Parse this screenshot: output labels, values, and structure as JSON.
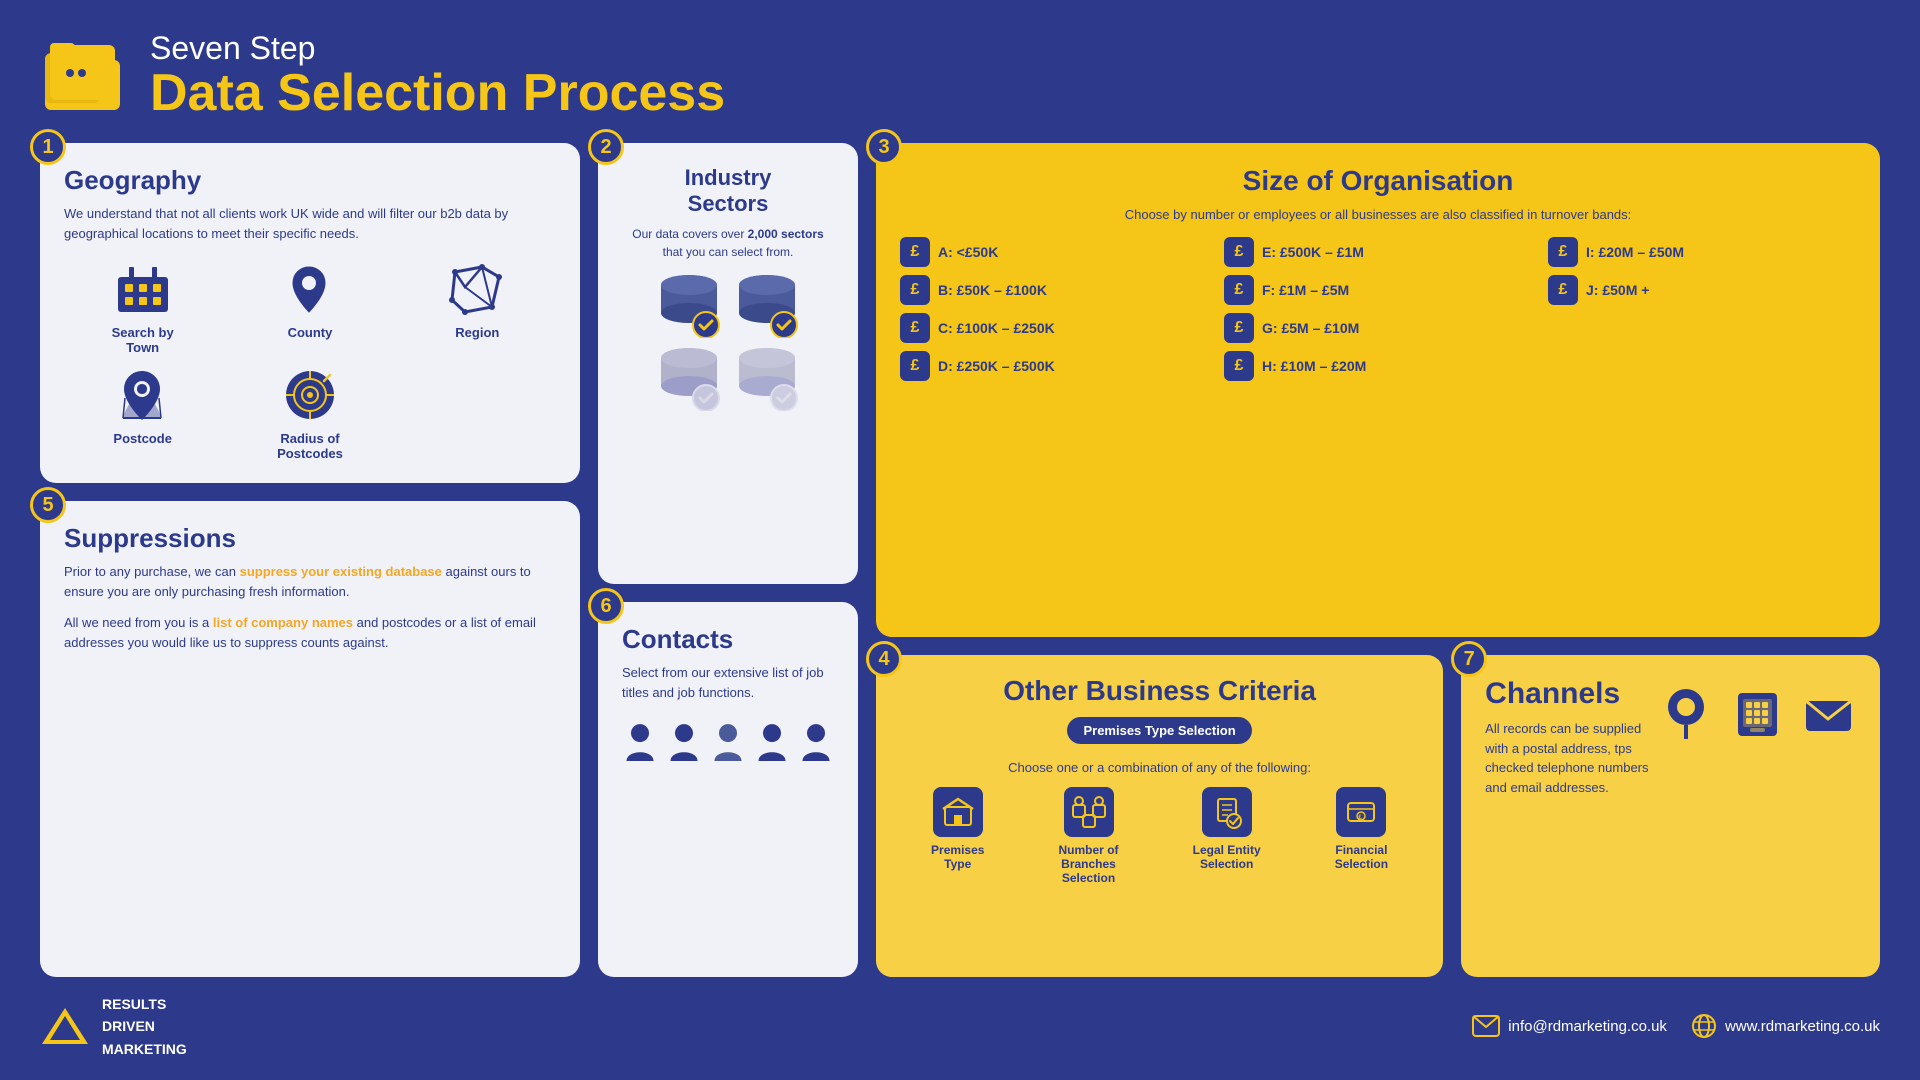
{
  "header": {
    "subtitle": "Seven Step",
    "title": "Data Selection Process"
  },
  "steps": {
    "geography": {
      "number": "1",
      "title": "Geography",
      "body": "We understand that not all clients work UK wide and will filter our b2b data by geographical locations to meet their specific needs.",
      "icons": [
        {
          "label": "Search by Town",
          "name": "search-by-town"
        },
        {
          "label": "County",
          "name": "county"
        },
        {
          "label": "Region",
          "name": "region"
        },
        {
          "label": "Postcode",
          "name": "postcode"
        },
        {
          "label": "Radius of Postcodes",
          "name": "radius-postcodes"
        }
      ]
    },
    "industry": {
      "number": "2",
      "title": "Industry Sectors",
      "body": "Our data covers over ",
      "body_bold": "2,000 sectors",
      "body_end": " that you can select from."
    },
    "size": {
      "number": "3",
      "title": "Size of Organisation",
      "subtitle": "Choose by number or employees or all businesses are also classified in turnover bands:",
      "bands": [
        {
          "label": "A: <£50K"
        },
        {
          "label": "E: £500K – £1M"
        },
        {
          "label": "I: £20M – £50M"
        },
        {
          "label": "B: £50K – £100K"
        },
        {
          "label": "F: £1M – £5M"
        },
        {
          "label": "J: £50M +"
        },
        {
          "label": "C: £100K – £250K"
        },
        {
          "label": "G: £5M – £10M"
        },
        {
          "label": ""
        },
        {
          "label": "D: £250K – £500K"
        },
        {
          "label": "H: £10M – £20M"
        },
        {
          "label": ""
        }
      ]
    },
    "other": {
      "number": "4",
      "title": "Other Business Criteria",
      "badge": "Premises Type Selection",
      "subtitle": "Choose one or a combination of any of the following:",
      "items": [
        {
          "label": "Premises Type",
          "name": "premises-type"
        },
        {
          "label": "Number of Branches Selection",
          "name": "branches"
        },
        {
          "label": "Legal Entity Selection",
          "name": "legal-entity"
        },
        {
          "label": "Financial Selection",
          "name": "financial"
        }
      ]
    },
    "suppressions": {
      "number": "5",
      "title": "Suppressions",
      "body1": "Prior to any purchase, we can ",
      "body1_highlight": "suppress your existing database",
      "body1_end": " against ours to ensure you are only purchasing fresh information.",
      "body2_start": "All we need from you is a ",
      "body2_highlight": "list of company names",
      "body2_end": " and postcodes or a list of email addresses you would like us to suppress counts against."
    },
    "contacts": {
      "number": "6",
      "title": "Contacts",
      "body": "Select from our extensive list of job titles and job functions."
    },
    "channels": {
      "number": "7",
      "title": "Channels",
      "body": "All records can be supplied with a postal address, tps checked telephone numbers and email addresses."
    }
  },
  "footer": {
    "logo_line1": "RESULTS",
    "logo_line2": "DRIVEN",
    "logo_line3": "MARKETING",
    "email": "info@rdmarketing.co.uk",
    "website": "www.rdmarketing.co.uk"
  }
}
